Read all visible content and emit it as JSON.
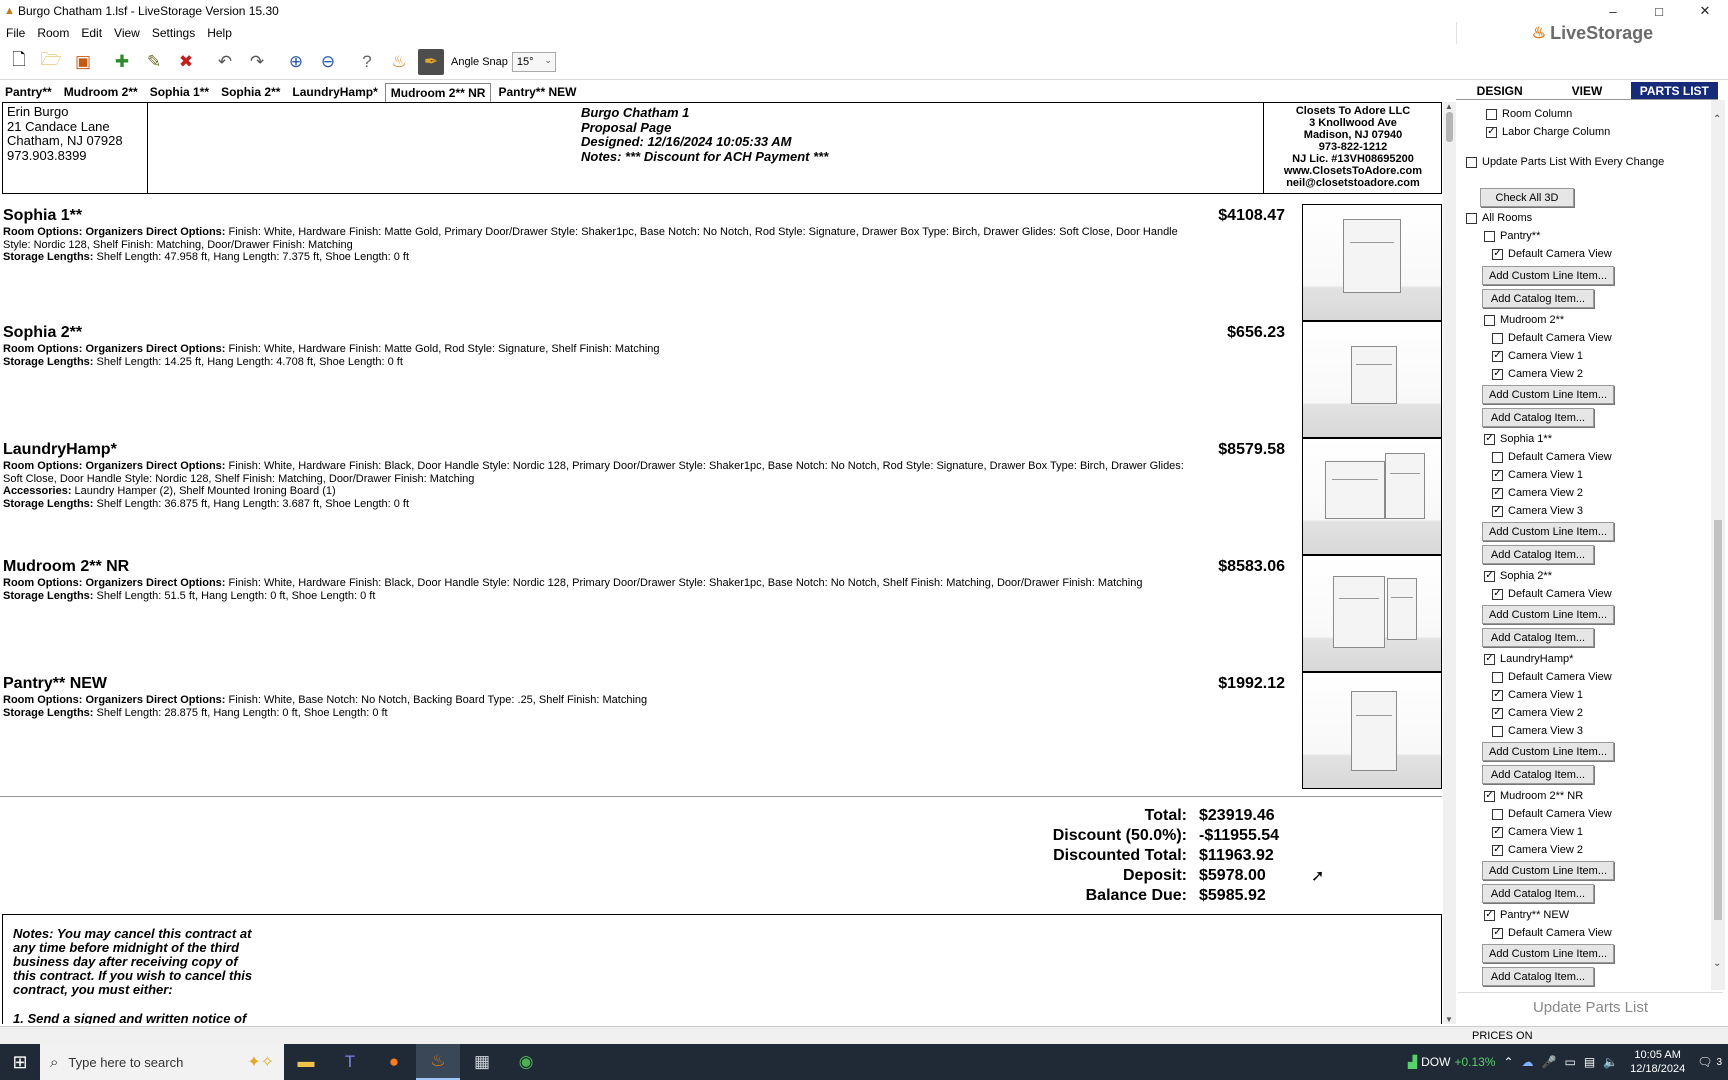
{
  "window": {
    "title": "Burgo Chatham 1.lsf - LiveStorage Version 15.30",
    "controls": [
      "–",
      "□",
      "✕"
    ]
  },
  "menu": [
    "File",
    "Room",
    "Edit",
    "View",
    "Settings",
    "Help"
  ],
  "brand": "LiveStorage",
  "toolbar": {
    "angle_snap_label": "Angle Snap",
    "angle_snap_value": "15°"
  },
  "room_tabs": [
    "Pantry**",
    "Mudroom 2**",
    "Sophia 1**",
    "Sophia 2**",
    "LaundryHamp*",
    "Mudroom 2** NR",
    "Pantry** NEW"
  ],
  "view_tabs": [
    "DESIGN",
    "VIEW",
    "PARTS LIST"
  ],
  "header": {
    "customer": [
      "Erin Burgo",
      "21 Candace Lane",
      "Chatham, NJ 07928",
      "973.903.8399"
    ],
    "proposal": [
      "Burgo Chatham 1",
      "Proposal Page",
      "Designed: 12/16/2024 10:05:33 AM",
      "Notes: *** Discount for ACH Payment ***"
    ],
    "company": [
      "Closets To Adore LLC",
      "3 Knollwood Ave",
      "Madison, NJ 07940",
      "973-822-1212",
      "NJ Lic. #13VH08695200",
      "www.ClosetsToAdore.com",
      "neil@closetstoadore.com"
    ]
  },
  "rooms": [
    {
      "name": "Sophia 1**",
      "price": "$4108.47",
      "lines": [
        {
          "label": "Room Options: Organizers Direct Options:",
          "text": " Finish: White, Hardware Finish: Matte Gold, Primary Door/Drawer Style: Shaker1pc, Base Notch: No Notch, Rod Style: Signature, Drawer Box Type: Birch, Drawer Glides: Soft Close, Door Handle Style: Nordic 128, Shelf Finish: Matching, Door/Drawer Finish: Matching"
        },
        {
          "label": "Storage Lengths:",
          "text": "  Shelf Length: 47.958 ft, Hang Length: 7.375 ft, Shoe Length: 0 ft"
        }
      ]
    },
    {
      "name": "Sophia 2**",
      "price": "$656.23",
      "lines": [
        {
          "label": "Room Options: Organizers Direct Options:",
          "text": " Finish: White, Hardware Finish: Matte Gold, Rod Style: Signature, Shelf Finish: Matching"
        },
        {
          "label": "Storage Lengths:",
          "text": "  Shelf Length: 14.25 ft, Hang Length: 4.708 ft, Shoe Length: 0 ft"
        }
      ]
    },
    {
      "name": "LaundryHamp*",
      "price": "$8579.58",
      "lines": [
        {
          "label": "Room Options: Organizers Direct Options:",
          "text": " Finish: White, Hardware Finish: Black, Door Handle Style: Nordic 128, Primary Door/Drawer Style: Shaker1pc, Base Notch: No Notch, Rod Style: Signature, Drawer Box Type: Birch, Drawer Glides: Soft Close, Door Handle Style: Nordic 128, Shelf Finish: Matching, Door/Drawer Finish: Matching"
        },
        {
          "label": "Accessories:",
          "text": " Laundry Hamper (2), Shelf Mounted Ironing Board (1)"
        },
        {
          "label": "Storage Lengths:",
          "text": "  Shelf Length: 36.875 ft, Hang Length: 3.687 ft, Shoe Length: 0 ft"
        }
      ]
    },
    {
      "name": "Mudroom 2** NR",
      "price": "$8583.06",
      "lines": [
        {
          "label": "Room Options: Organizers Direct Options:",
          "text": " Finish: White, Hardware Finish: Black, Door Handle Style: Nordic 128, Primary Door/Drawer Style: Shaker1pc, Base Notch: No Notch, Shelf Finish: Matching, Door/Drawer Finish: Matching"
        },
        {
          "label": "Storage Lengths:",
          "text": "  Shelf Length: 51.5 ft, Hang Length: 0 ft, Shoe Length: 0 ft"
        }
      ]
    },
    {
      "name": "Pantry** NEW",
      "price": "$1992.12",
      "lines": [
        {
          "label": "Room Options: Organizers Direct Options:",
          "text": " Finish: White, Base Notch: No Notch, Backing Board Type: .25, Shelf Finish: Matching"
        },
        {
          "label": "Storage Lengths:",
          "text": "  Shelf Length: 28.875 ft, Hang Length: 0 ft, Shoe Length: 0 ft"
        }
      ]
    }
  ],
  "totals": [
    {
      "label": "Total:",
      "value": "$23919.46"
    },
    {
      "label": "Discount (50.0%):",
      "value": "-$11955.54"
    },
    {
      "label": "Discounted Total:",
      "value": "$11963.92"
    },
    {
      "label": "Deposit:",
      "value": "$5978.00"
    },
    {
      "label": "Balance Due:",
      "value": "$5985.92"
    }
  ],
  "notes": {
    "text": "Notes: You may cancel this contract at any time before midnight of the third business day after receiving copy of this contract. If you wish to cancel this contract, you must either:",
    "item1": "1. Send a signed and written notice of"
  },
  "parts_panel": {
    "room_column": "Room Column",
    "labor_column": "Labor Charge Column",
    "update_every_change": "Update Parts List With Every Change",
    "check_all_3d": "Check All 3D",
    "all_rooms": "All Rooms",
    "add_custom": "Add Custom Line Item...",
    "add_catalog": "Add Catalog Item...",
    "default_cam": "Default Camera View",
    "cam1": "Camera View 1",
    "cam2": "Camera View 2",
    "cam3": "Camera View 3",
    "room_pantry": "Pantry**",
    "room_mudroom": "Mudroom 2**",
    "room_sophia1": "Sophia 1**",
    "room_sophia2": "Sophia 2**",
    "room_laundry": "LaundryHamp*",
    "room_mudroom_nr": "Mudroom 2** NR",
    "room_pantry_new": "Pantry** NEW",
    "update_button": "Update Parts List"
  },
  "status": {
    "prices": "PRICES ON"
  },
  "taskbar": {
    "search_placeholder": "Type here to search",
    "stock_name": "DOW",
    "stock_change": "+0.13%",
    "time": "10:05 AM",
    "date": "12/18/2024",
    "notif_count": "3"
  }
}
